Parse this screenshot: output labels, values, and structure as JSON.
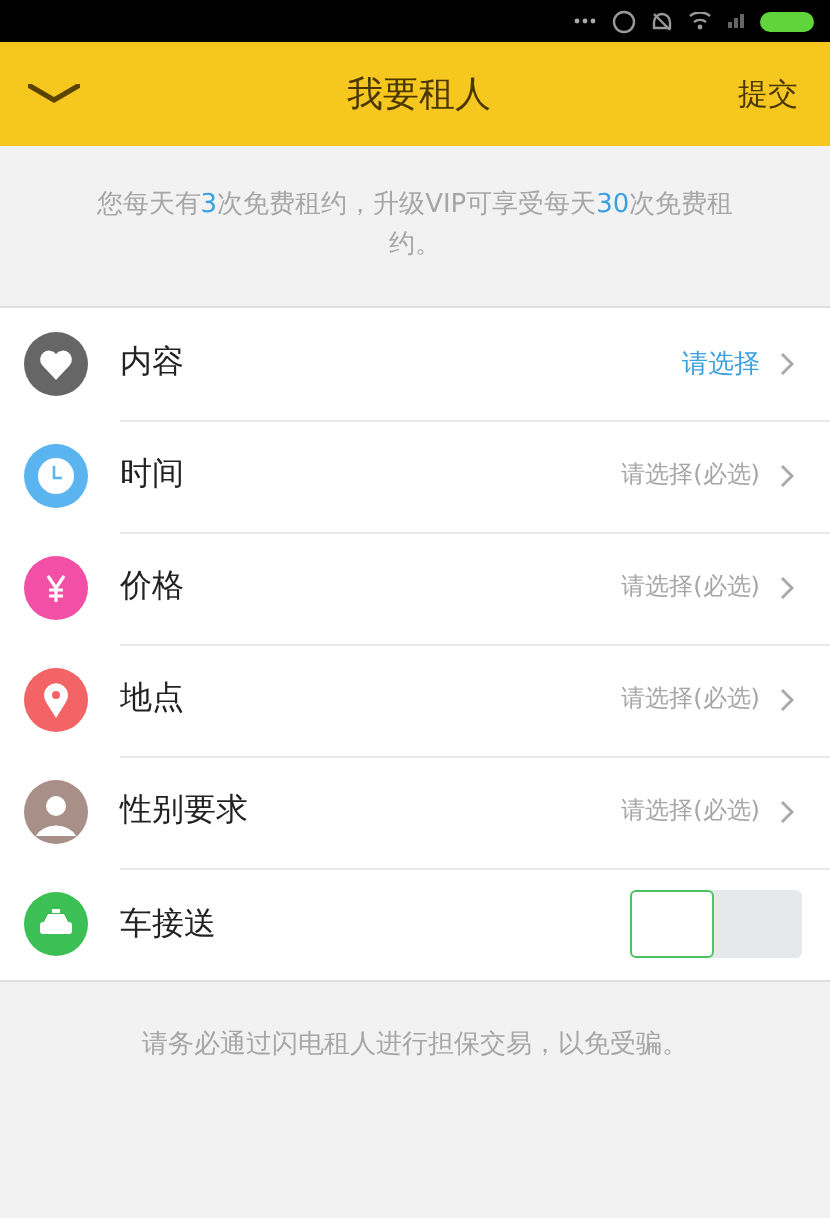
{
  "header": {
    "title": "我要租人",
    "action": "提交"
  },
  "notice": [
    {
      "text": "您每天有",
      "highlighted": false
    },
    {
      "text": "3",
      "highlighted": true
    },
    {
      "text": "次免费租约，升级VIP可享受每天",
      "highlighted": false
    },
    {
      "text": "30",
      "highlighted": true
    },
    {
      "text": "次免费租约。",
      "highlighted": false
    }
  ],
  "rows": [
    {
      "kind": "select",
      "color": "#666666",
      "label": "内容",
      "value": "请选择",
      "highlighted": true
    },
    {
      "kind": "select",
      "color": "#5ab4f0",
      "label": "时间",
      "value": "请选择(必选)",
      "highlighted": false
    },
    {
      "kind": "select",
      "color": "#f24fa6",
      "label": "价格",
      "value": "请选择(必选)",
      "highlighted": false
    },
    {
      "kind": "select",
      "color": "#f26466",
      "label": "地点",
      "value": "请选择(必选)",
      "highlighted": false
    },
    {
      "kind": "select",
      "color": "#a89088",
      "label": "性别要求",
      "value": "请选择(必选)",
      "highlighted": false
    },
    {
      "kind": "toggle",
      "color": "#3cbf55",
      "label": "车接送",
      "on": false
    }
  ],
  "footer": "请务必通过闪电租人进行担保交易，以免受骗。"
}
